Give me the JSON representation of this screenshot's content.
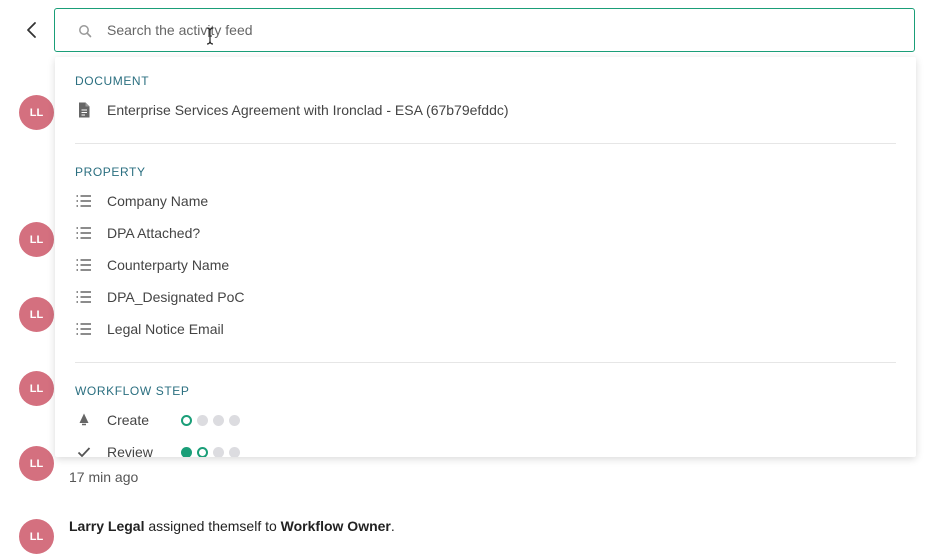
{
  "search": {
    "placeholder": "Search the activity feed"
  },
  "feed": {
    "avatar_initials": "LL",
    "items": [
      {
        "time": "17 min ago"
      },
      {
        "actor": "Larry Legal",
        "action": " assigned themself to ",
        "target": "Workflow Owner",
        "end": "."
      }
    ]
  },
  "dropdown": {
    "sections": [
      {
        "title": "DOCUMENT",
        "items": [
          {
            "label": "Enterprise Services Agreement with Ironclad - ESA (67b79efddc)",
            "icon": "document-icon"
          }
        ]
      },
      {
        "title": "PROPERTY",
        "items": [
          {
            "label": "Company Name",
            "icon": "list-icon"
          },
          {
            "label": "DPA Attached?",
            "icon": "list-icon"
          },
          {
            "label": "Counterparty Name",
            "icon": "list-icon"
          },
          {
            "label": "DPA_Designated PoC",
            "icon": "list-icon"
          },
          {
            "label": "Legal Notice Email",
            "icon": "list-icon"
          }
        ]
      },
      {
        "title": "WORKFLOW STEP",
        "items": [
          {
            "label": "Create",
            "icon": "create-step-icon",
            "progress_step": 1,
            "progress_total": 4
          },
          {
            "label": "Review",
            "icon": "check-icon",
            "progress_step": 2,
            "progress_total": 4
          }
        ]
      }
    ]
  },
  "colors": {
    "accent": "#1a9e78",
    "avatar": "#d4707f",
    "section_title": "#2b6f80"
  }
}
